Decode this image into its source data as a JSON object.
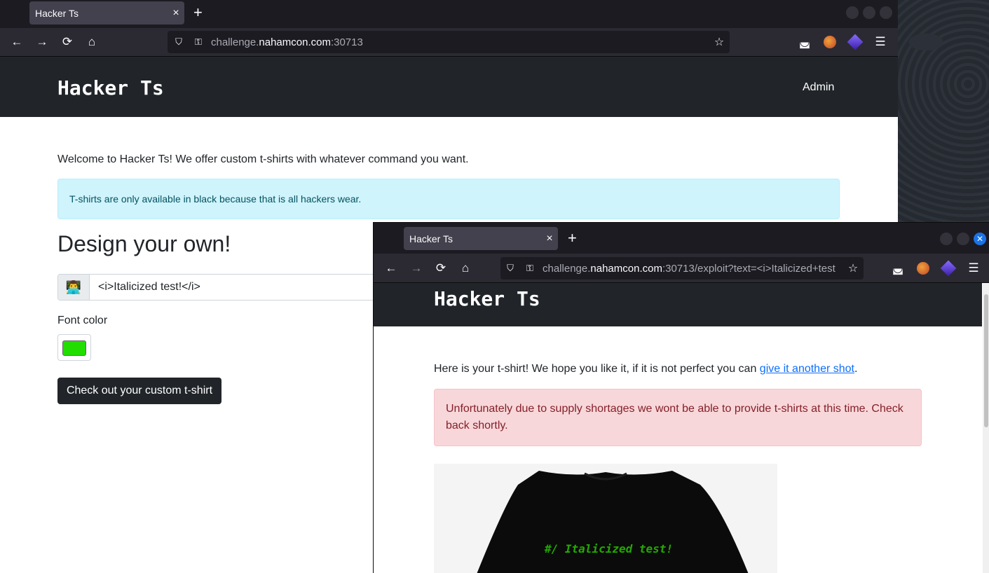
{
  "main_window": {
    "tab_title": "Hacker Ts",
    "tab_close": "×",
    "new_tab": "+",
    "url": {
      "prefix": "challenge.",
      "host": "nahamcon.com",
      "suffix": ":30713"
    },
    "site": {
      "brand": "Hacker Ts",
      "nav_admin": "Admin",
      "welcome": "Welcome to Hacker Ts! We offer custom t-shirts with whatever command you want.",
      "info_alert": "T-shirts are only available in black because that is all hackers wear.",
      "heading": "Design your own!",
      "addon_emoji": "👨‍💻",
      "text_input_value": "<i>Italicized test!</i>",
      "font_color_label": "Font color",
      "font_color_value": "#22dd00",
      "submit_button": "Check out your custom t-shirt"
    }
  },
  "popup_window": {
    "tab_title": "Hacker Ts",
    "tab_close": "×",
    "new_tab": "+",
    "url": {
      "prefix": "challenge.",
      "host": "nahamcon.com",
      "suffix": ":30713/exploit?text=<i>Italicized+test"
    },
    "site": {
      "brand": "Hacker Ts",
      "intro_before": "Here is your t-shirt! We hope you like it, if it is not perfect you can ",
      "intro_link": "give it another shot",
      "intro_after": ".",
      "danger_alert": "Unfortunately due to supply shortages we wont be able to provide t-shirts at this time. Check back shortly.",
      "shirt_text": "#/ Italicized test!",
      "shirt_text_color": "#22aa00"
    }
  },
  "icons": {
    "back": "←",
    "forward": "→",
    "reload": "⟳",
    "home": "⌂",
    "shield": "⛉",
    "lock": "🔒",
    "star": "☆",
    "pocket": "◛",
    "menu": "☰",
    "close_x": "✕"
  }
}
